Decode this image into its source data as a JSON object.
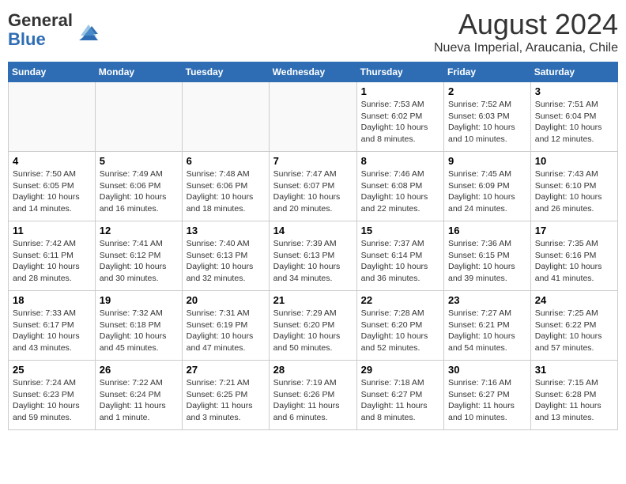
{
  "header": {
    "logo_general": "General",
    "logo_blue": "Blue",
    "month_year": "August 2024",
    "location": "Nueva Imperial, Araucania, Chile"
  },
  "weekdays": [
    "Sunday",
    "Monday",
    "Tuesday",
    "Wednesday",
    "Thursday",
    "Friday",
    "Saturday"
  ],
  "weeks": [
    [
      {
        "day": "",
        "info": ""
      },
      {
        "day": "",
        "info": ""
      },
      {
        "day": "",
        "info": ""
      },
      {
        "day": "",
        "info": ""
      },
      {
        "day": "1",
        "info": "Sunrise: 7:53 AM\nSunset: 6:02 PM\nDaylight: 10 hours\nand 8 minutes."
      },
      {
        "day": "2",
        "info": "Sunrise: 7:52 AM\nSunset: 6:03 PM\nDaylight: 10 hours\nand 10 minutes."
      },
      {
        "day": "3",
        "info": "Sunrise: 7:51 AM\nSunset: 6:04 PM\nDaylight: 10 hours\nand 12 minutes."
      }
    ],
    [
      {
        "day": "4",
        "info": "Sunrise: 7:50 AM\nSunset: 6:05 PM\nDaylight: 10 hours\nand 14 minutes."
      },
      {
        "day": "5",
        "info": "Sunrise: 7:49 AM\nSunset: 6:06 PM\nDaylight: 10 hours\nand 16 minutes."
      },
      {
        "day": "6",
        "info": "Sunrise: 7:48 AM\nSunset: 6:06 PM\nDaylight: 10 hours\nand 18 minutes."
      },
      {
        "day": "7",
        "info": "Sunrise: 7:47 AM\nSunset: 6:07 PM\nDaylight: 10 hours\nand 20 minutes."
      },
      {
        "day": "8",
        "info": "Sunrise: 7:46 AM\nSunset: 6:08 PM\nDaylight: 10 hours\nand 22 minutes."
      },
      {
        "day": "9",
        "info": "Sunrise: 7:45 AM\nSunset: 6:09 PM\nDaylight: 10 hours\nand 24 minutes."
      },
      {
        "day": "10",
        "info": "Sunrise: 7:43 AM\nSunset: 6:10 PM\nDaylight: 10 hours\nand 26 minutes."
      }
    ],
    [
      {
        "day": "11",
        "info": "Sunrise: 7:42 AM\nSunset: 6:11 PM\nDaylight: 10 hours\nand 28 minutes."
      },
      {
        "day": "12",
        "info": "Sunrise: 7:41 AM\nSunset: 6:12 PM\nDaylight: 10 hours\nand 30 minutes."
      },
      {
        "day": "13",
        "info": "Sunrise: 7:40 AM\nSunset: 6:13 PM\nDaylight: 10 hours\nand 32 minutes."
      },
      {
        "day": "14",
        "info": "Sunrise: 7:39 AM\nSunset: 6:13 PM\nDaylight: 10 hours\nand 34 minutes."
      },
      {
        "day": "15",
        "info": "Sunrise: 7:37 AM\nSunset: 6:14 PM\nDaylight: 10 hours\nand 36 minutes."
      },
      {
        "day": "16",
        "info": "Sunrise: 7:36 AM\nSunset: 6:15 PM\nDaylight: 10 hours\nand 39 minutes."
      },
      {
        "day": "17",
        "info": "Sunrise: 7:35 AM\nSunset: 6:16 PM\nDaylight: 10 hours\nand 41 minutes."
      }
    ],
    [
      {
        "day": "18",
        "info": "Sunrise: 7:33 AM\nSunset: 6:17 PM\nDaylight: 10 hours\nand 43 minutes."
      },
      {
        "day": "19",
        "info": "Sunrise: 7:32 AM\nSunset: 6:18 PM\nDaylight: 10 hours\nand 45 minutes."
      },
      {
        "day": "20",
        "info": "Sunrise: 7:31 AM\nSunset: 6:19 PM\nDaylight: 10 hours\nand 47 minutes."
      },
      {
        "day": "21",
        "info": "Sunrise: 7:29 AM\nSunset: 6:20 PM\nDaylight: 10 hours\nand 50 minutes."
      },
      {
        "day": "22",
        "info": "Sunrise: 7:28 AM\nSunset: 6:20 PM\nDaylight: 10 hours\nand 52 minutes."
      },
      {
        "day": "23",
        "info": "Sunrise: 7:27 AM\nSunset: 6:21 PM\nDaylight: 10 hours\nand 54 minutes."
      },
      {
        "day": "24",
        "info": "Sunrise: 7:25 AM\nSunset: 6:22 PM\nDaylight: 10 hours\nand 57 minutes."
      }
    ],
    [
      {
        "day": "25",
        "info": "Sunrise: 7:24 AM\nSunset: 6:23 PM\nDaylight: 10 hours\nand 59 minutes."
      },
      {
        "day": "26",
        "info": "Sunrise: 7:22 AM\nSunset: 6:24 PM\nDaylight: 11 hours\nand 1 minute."
      },
      {
        "day": "27",
        "info": "Sunrise: 7:21 AM\nSunset: 6:25 PM\nDaylight: 11 hours\nand 3 minutes."
      },
      {
        "day": "28",
        "info": "Sunrise: 7:19 AM\nSunset: 6:26 PM\nDaylight: 11 hours\nand 6 minutes."
      },
      {
        "day": "29",
        "info": "Sunrise: 7:18 AM\nSunset: 6:27 PM\nDaylight: 11 hours\nand 8 minutes."
      },
      {
        "day": "30",
        "info": "Sunrise: 7:16 AM\nSunset: 6:27 PM\nDaylight: 11 hours\nand 10 minutes."
      },
      {
        "day": "31",
        "info": "Sunrise: 7:15 AM\nSunset: 6:28 PM\nDaylight: 11 hours\nand 13 minutes."
      }
    ]
  ]
}
